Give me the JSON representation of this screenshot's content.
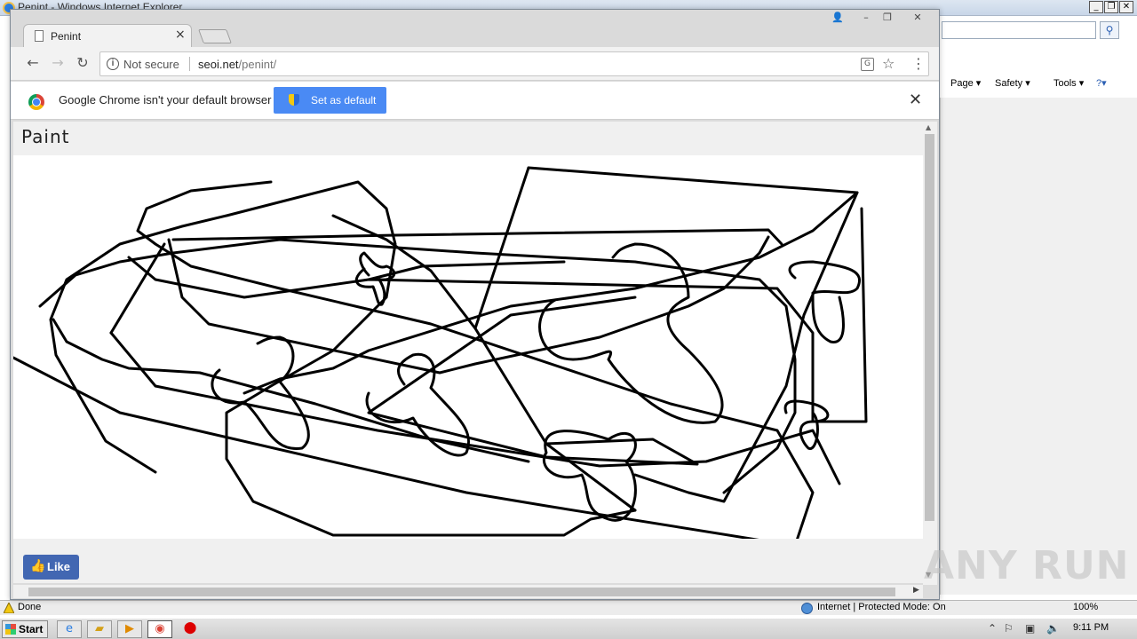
{
  "ie": {
    "title": "Penint - Windows Internet Explorer",
    "title_buttons": [
      "_",
      "❐",
      "✕"
    ],
    "search_icon": "search-icon",
    "command_bar": [
      "Page ▾",
      "Safety ▾",
      "Tools ▾",
      "?▾"
    ],
    "status": {
      "done": "Done",
      "zone": "Internet | Protected Mode: On",
      "zoom": "100%"
    }
  },
  "chrome": {
    "window_buttons": [
      "👤",
      "–",
      "❐",
      "✕"
    ],
    "tab": {
      "title": "Penint",
      "close": "×"
    },
    "toolbar": {
      "back": "←",
      "forward": "→",
      "reload": "↻",
      "security_label": "Not secure",
      "url_host": "seoi.net",
      "url_path": "/penint/",
      "star": "☆",
      "menu": "⋮",
      "translate": "G"
    },
    "infobar": {
      "message": "Google Chrome isn't your default browser",
      "button": "Set as default",
      "close": "✕"
    }
  },
  "page": {
    "heading": "Paint",
    "like_label": "Like",
    "like_icon": "👍"
  },
  "watermark": "ANY RUN",
  "taskbar": {
    "start": "Start",
    "clock": "9:11 PM"
  },
  "colors": {
    "like_blue": "#4267b2",
    "set_default_blue": "#4a8af4",
    "stroke": "#000000"
  }
}
